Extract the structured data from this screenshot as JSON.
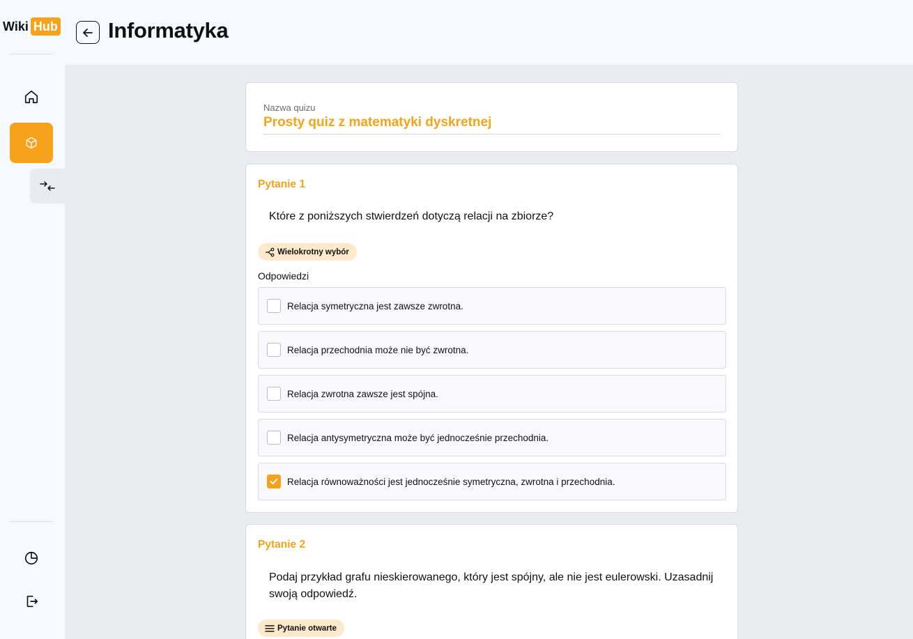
{
  "app": {
    "logo_left": "Wiki",
    "logo_right": "Hub",
    "accent": "#f7a21b"
  },
  "sidebar": {
    "items": [
      {
        "name": "home",
        "icon": "home-icon",
        "active": false
      },
      {
        "name": "cube",
        "icon": "cube-icon",
        "active": true
      },
      {
        "name": "stats",
        "icon": "pie-chart-icon",
        "active": false
      },
      {
        "name": "logout",
        "icon": "logout-icon",
        "active": false
      }
    ],
    "collapse_icon": "collapse-arrows-icon"
  },
  "header": {
    "back_icon": "arrow-left-icon",
    "title": "Informatyka"
  },
  "quiz": {
    "name_label": "Nazwa quizu",
    "name_value": "Prosty quiz z matematyki dyskretnej"
  },
  "questions": [
    {
      "title": "Pytanie 1",
      "text": "Które z poniższych stwierdzeń dotyczą relacji na zbiorze?",
      "type_label": "Wielokrotny wybór",
      "type_icon": "share-nodes-icon",
      "answers_label": "Odpowiedzi",
      "answers": [
        {
          "text": "Relacja symetryczna jest zawsze zwrotna.",
          "checked": false
        },
        {
          "text": "Relacja przechodnia może nie być zwrotna.",
          "checked": false
        },
        {
          "text": "Relacja zwrotna zawsze jest spójna.",
          "checked": false
        },
        {
          "text": "Relacja antysymetryczna może być jednocześnie przechodnia.",
          "checked": false
        },
        {
          "text": "Relacja równoważności jest jednocześnie symetryczna, zwrotna i przechodnia.",
          "checked": true
        }
      ]
    },
    {
      "title": "Pytanie 2",
      "text": "Podaj przykład grafu nieskierowanego, który jest spójny, ale nie jest eulerowski. Uzasadnij swoją odpowiedź.",
      "type_label": "Pytanie otwarte",
      "type_icon": "lines-icon"
    }
  ]
}
